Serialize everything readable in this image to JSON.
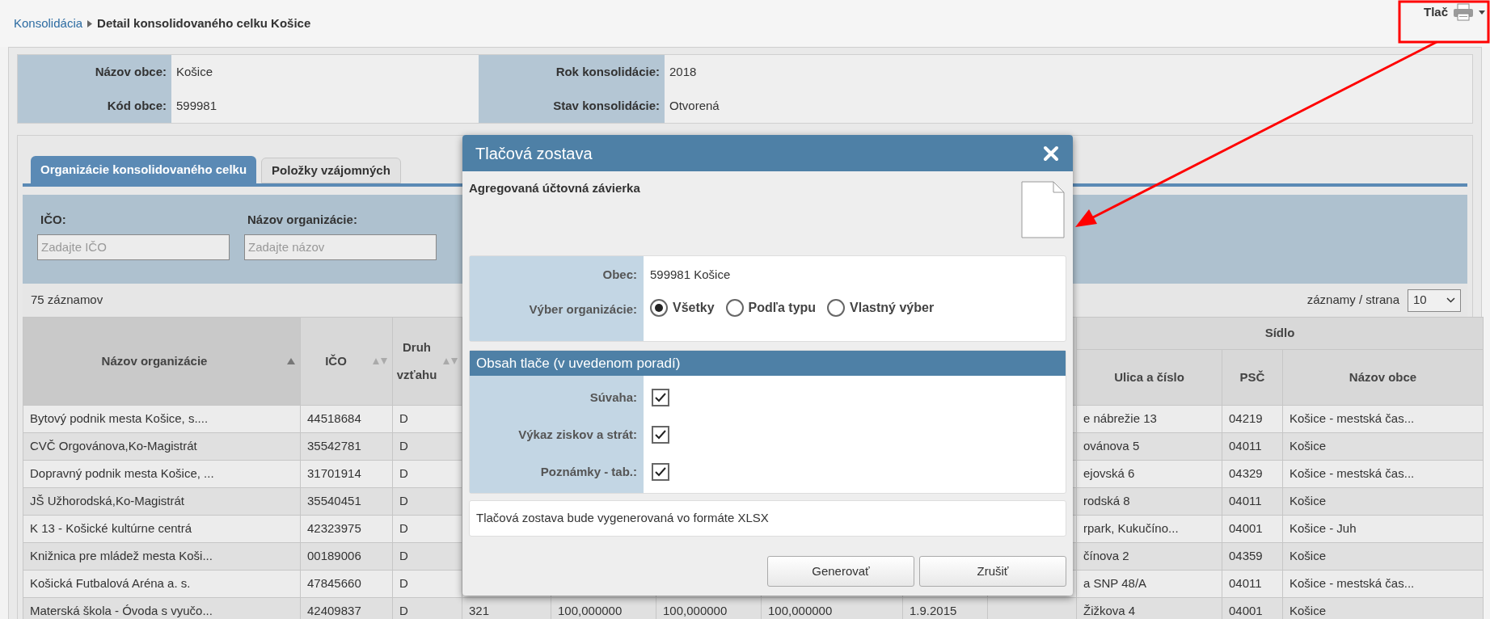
{
  "breadcrumb": {
    "link": "Konsolidácia",
    "current": "Detail konsolidovaného celku Košice"
  },
  "print_button": {
    "label": "Tlač"
  },
  "info": [
    {
      "label": "Názov obce:",
      "value": "Košice"
    },
    {
      "label": "Rok konsolidácie:",
      "value": "2018"
    },
    {
      "label": "Kód obce:",
      "value": "599981"
    },
    {
      "label": "Stav konsolidácie:",
      "value": "Otvorená"
    }
  ],
  "tabs": [
    {
      "label": "Organizácie konsolidovaného celku",
      "selected": true
    },
    {
      "label": "Položky vzájomných",
      "selected": false
    }
  ],
  "filters": [
    {
      "label": "IČO:",
      "placeholder": "Zadajte IČO"
    },
    {
      "label": "Názov organizácie:",
      "placeholder": "Zadajte názov"
    }
  ],
  "record_count": "75 záznamov",
  "page_size": {
    "label": "záznamy / strana",
    "value": "10"
  },
  "table": {
    "columns": [
      {
        "label": "Názov organizácie",
        "sorted": true
      },
      {
        "label": "IČO",
        "sorted": false
      },
      {
        "label": "Druh vzťahu",
        "sorted": false
      }
    ],
    "group_header": "Sídlo",
    "address_columns": [
      "Ulica a číslo",
      "PSČ",
      "Názov obce"
    ],
    "rows": [
      {
        "name": "Bytový podnik mesta Košice, s....",
        "ico": "44518684",
        "relation": "D",
        "street": "e nábrežie 13",
        "psc": "04219",
        "town": "Košice - mestská čas..."
      },
      {
        "name": "CVČ Orgovánova,Ko-Magistrát",
        "ico": "35542781",
        "relation": "D",
        "street": "ovánova 5",
        "psc": "04011",
        "town": "Košice"
      },
      {
        "name": "Dopravný podnik mesta Košice, ...",
        "ico": "31701914",
        "relation": "D",
        "street": "ejovská 6",
        "psc": "04329",
        "town": "Košice - mestská čas..."
      },
      {
        "name": "JŠ Užhorodská,Ko-Magistrát",
        "ico": "35540451",
        "relation": "D",
        "street": "rodská 8",
        "psc": "04011",
        "town": "Košice"
      },
      {
        "name": "K 13 - Košické kultúrne centrá",
        "ico": "42323975",
        "relation": "D",
        "street": "rpark, Kukučíno...",
        "psc": "04001",
        "town": "Košice - Juh"
      },
      {
        "name": "Knižnica pre mládež mesta Koši...",
        "ico": "00189006",
        "relation": "D",
        "street": "čínova 2",
        "psc": "04359",
        "town": "Košice"
      },
      {
        "name": "Košická Futbalová Aréna a. s.",
        "ico": "47845660",
        "relation": "D",
        "street": "a SNP 48/A",
        "psc": "04011",
        "town": "Košice - mestská čas..."
      },
      {
        "name": "Materská škola - Óvoda s vyučo...",
        "ico": "42409837",
        "relation": "D",
        "middle": [
          "321",
          "100,000000",
          "100,000000",
          "100,000000",
          "1.9.2015"
        ],
        "street": "Žižkova 4",
        "psc": "04001",
        "town": "Košice"
      }
    ]
  },
  "dialog": {
    "title": "Tlačová zostava",
    "subtitle": "Agregovaná účtovná závierka",
    "municipality": {
      "label": "Obec:",
      "value": "599981 Košice"
    },
    "selection": {
      "label": "Výber organizácie:",
      "options": [
        {
          "label": "Všetky",
          "selected": true
        },
        {
          "label": "Podľa typu",
          "selected": false
        },
        {
          "label": "Vlastný výber",
          "selected": false
        }
      ]
    },
    "contents_header": "Obsah tlače (v uvedenom poradí)",
    "contents": [
      {
        "label": "Súvaha:",
        "checked": true
      },
      {
        "label": "Výkaz ziskov a strát:",
        "checked": true
      },
      {
        "label": "Poznámky - tab.:",
        "checked": true
      }
    ],
    "note": "Tlačová zostava bude vygenerovaná vo formáte XLSX",
    "buttons": [
      {
        "label": "Generovať"
      },
      {
        "label": "Zrušiť"
      }
    ]
  }
}
